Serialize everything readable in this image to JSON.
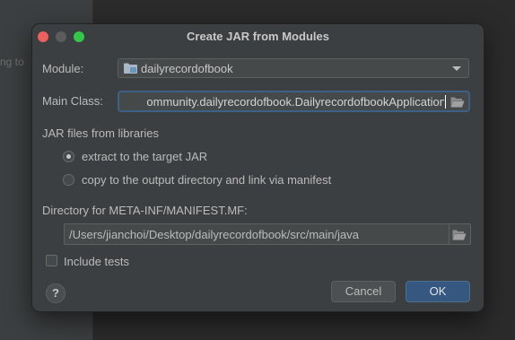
{
  "background": {
    "partial_text": "ng to"
  },
  "dialog": {
    "title": "Create JAR from Modules",
    "module_label": "Module:",
    "module_value": "dailyrecordofbook",
    "main_class_label": "Main Class:",
    "main_class_value": "ommunity.dailyrecordofbook.DailyrecordofbookApplication",
    "jar_section_label": "JAR files from libraries",
    "radio_options": [
      {
        "label": "extract to the target JAR",
        "selected": true
      },
      {
        "label": "copy to the output directory and link via manifest",
        "selected": false
      }
    ],
    "manifest_dir_label": "Directory for META-INF/MANIFEST.MF:",
    "manifest_dir_value": "/Users/jianchoi/Desktop/dailyrecordofbook/src/main/java",
    "include_tests_label": "Include tests",
    "include_tests_checked": false,
    "help_label": "?",
    "cancel_label": "Cancel",
    "ok_label": "OK"
  },
  "icons": {
    "module_icon": "folder-icon",
    "browse_icon": "open-folder-icon",
    "dropdown_icon": "chevron-down-icon"
  },
  "colors": {
    "dialog_bg": "#3c3f41",
    "focus_border": "#3d6185",
    "primary_button": "#365880",
    "close_button": "#ec5f5d",
    "zoom_button": "#34c84a"
  }
}
